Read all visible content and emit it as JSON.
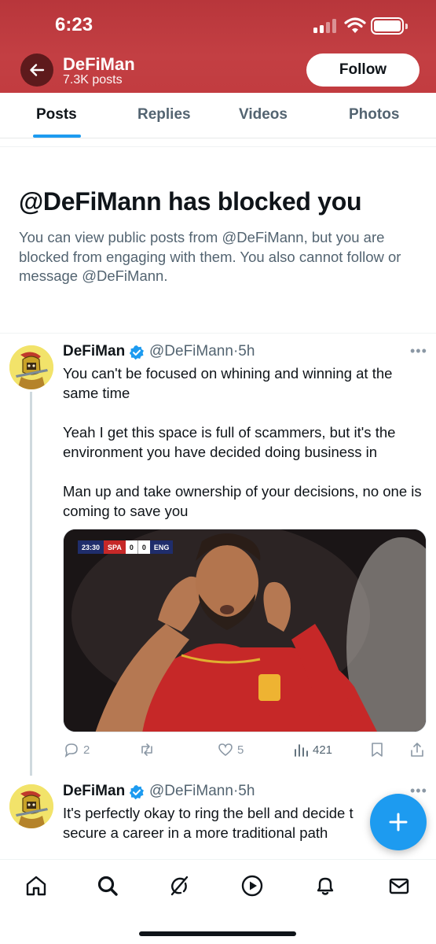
{
  "status_bar": {
    "time": "6:23"
  },
  "header": {
    "name": "DeFiMan",
    "posts_count": "7.3K posts",
    "follow_label": "Follow",
    "brand_color": "#c23c40"
  },
  "tabs": [
    {
      "label": "Posts",
      "active": true
    },
    {
      "label": "Replies",
      "active": false
    },
    {
      "label": "Videos",
      "active": false
    },
    {
      "label": "Photos",
      "active": false
    }
  ],
  "blocked": {
    "title": "@DeFiMann has blocked you",
    "message": "You can view public posts from @DeFiMann, but you are blocked from engaging with them. You also cannot follow or message @DeFiMann."
  },
  "tweets": [
    {
      "name": "DeFiMan",
      "handle": "@DeFiMann",
      "sep": "·",
      "time": "5h",
      "paragraphs": [
        "You can't be focused on whining and winning at the same time",
        "Yeah I get this space is full of scammers, but it's the environment you have decided doing business in",
        "Man up and take ownership of your decisions, no one is coming to save you"
      ],
      "media": {
        "scorebug_time": "23:30",
        "team_home": "SPA",
        "score_home": "0",
        "score_away": "0",
        "team_away": "ENG"
      },
      "stats": {
        "replies": "2",
        "retweets": "",
        "likes": "5",
        "views": "421"
      }
    },
    {
      "name": "DeFiMan",
      "handle": "@DeFiMann",
      "sep": "·",
      "time": "5h",
      "paragraphs": [
        "It's perfectly okay to ring the bell and decide t secure a career in a more traditional path"
      ]
    }
  ],
  "bottom_nav": [
    "home-icon",
    "search-icon",
    "grok-icon",
    "video-icon",
    "notifications-icon",
    "messages-icon"
  ],
  "colors": {
    "accent": "#1d9bf0",
    "text": "#0f1419",
    "muted": "#536471"
  }
}
